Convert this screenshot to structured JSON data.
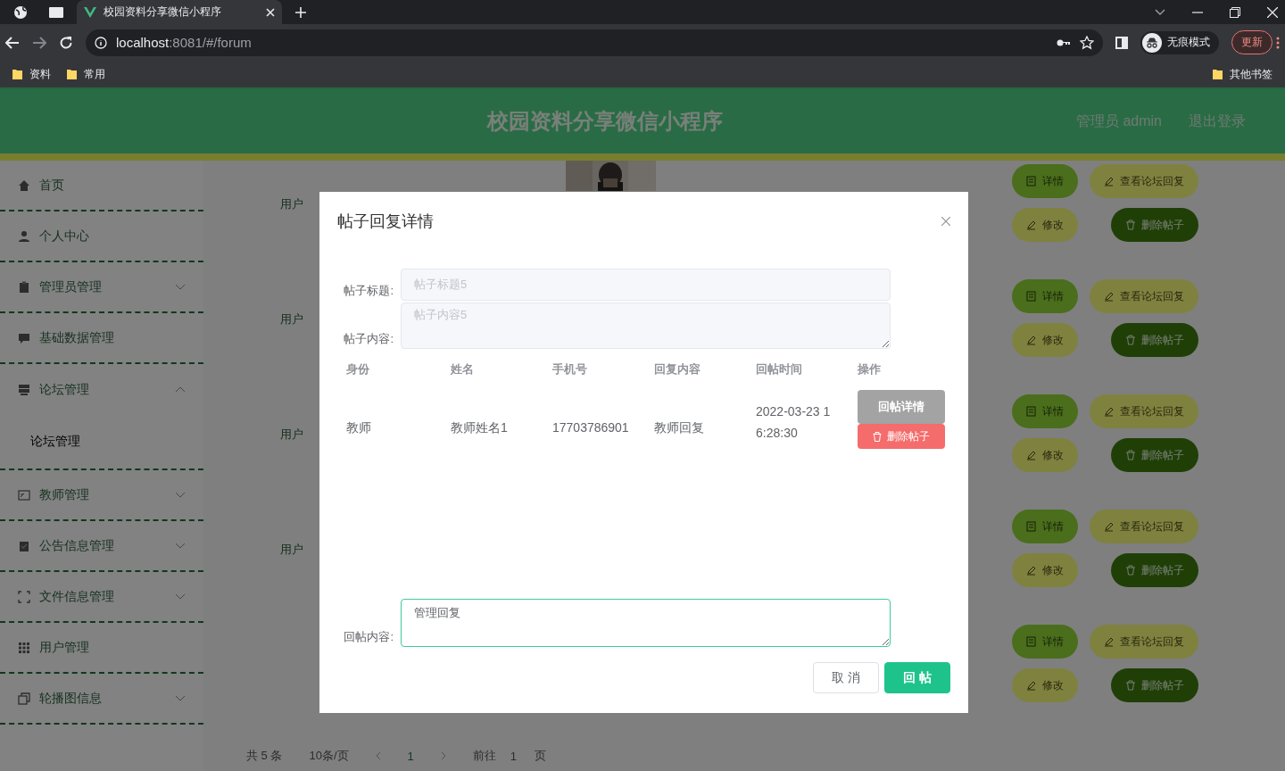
{
  "browser": {
    "tab_title": "校园资料分享微信小程序",
    "url_host": "localhost",
    "url_path": ":8081/#/forum",
    "incognito_label": "无痕模式",
    "update_button": "更新",
    "bookmarks": [
      "资料",
      "常用"
    ],
    "other_bookmarks": "其他书签"
  },
  "header": {
    "title": "校园资料分享微信小程序",
    "user": "管理员 admin",
    "logout": "退出登录"
  },
  "sidebar": {
    "items": [
      {
        "label": "首页"
      },
      {
        "label": "个人中心"
      },
      {
        "label": "管理员管理",
        "expanded": false
      },
      {
        "label": "基础数据管理"
      },
      {
        "label": "论坛管理",
        "expanded": true,
        "children": [
          {
            "label": "论坛管理",
            "selected": true
          }
        ]
      },
      {
        "label": "教师管理",
        "expanded": false
      },
      {
        "label": "公告信息管理",
        "expanded": false
      },
      {
        "label": "文件信息管理",
        "expanded": false
      },
      {
        "label": "用户管理"
      },
      {
        "label": "轮播图信息",
        "expanded": false
      }
    ]
  },
  "table": {
    "rows": [
      {
        "role": "用户",
        "buttons": [
          "详情",
          "查看论坛回复",
          "修改",
          "删除帖子"
        ]
      },
      {
        "role": "用户",
        "buttons": [
          "详情",
          "查看论坛回复",
          "修改",
          "删除帖子"
        ]
      },
      {
        "role": "用户",
        "buttons": [
          "详情",
          "查看论坛回复",
          "修改",
          "删除帖子"
        ]
      },
      {
        "role": "用户",
        "buttons": [
          "详情",
          "查看论坛回复",
          "修改",
          "删除帖子"
        ]
      },
      {
        "role": "",
        "buttons": [
          "详情",
          "查看论坛回复",
          "修改",
          "删除帖子"
        ]
      }
    ]
  },
  "pagination": {
    "total": "共 5 条",
    "page_size": "10条/页",
    "current_page": "1",
    "jump_label": "前往",
    "jump_value": "1",
    "jump_suffix": "页"
  },
  "dialog": {
    "title": "帖子回复详情",
    "fields": [
      {
        "label": "帖子标题:",
        "kind": "input",
        "value": "帖子标题5",
        "disabled": true
      },
      {
        "label": "帖子内容:",
        "kind": "textarea",
        "value": "帖子内容5",
        "disabled": true
      }
    ],
    "columns": [
      "身份",
      "姓名",
      "手机号",
      "回复内容",
      "回帖时间",
      "操作"
    ],
    "rows": [
      {
        "cells": [
          "教师",
          "教师姓名1",
          "17703786901",
          "教师回复",
          "2022-03-23 16:28:30"
        ],
        "actions": [
          "回帖详情",
          "删除帖子"
        ]
      }
    ],
    "reply": {
      "label": "回帖内容:",
      "value": "管理回复",
      "focused": true
    },
    "buttons": [
      {
        "label": "取 消",
        "kind": "secondary"
      },
      {
        "label": "回 帖",
        "kind": "primary"
      }
    ]
  }
}
